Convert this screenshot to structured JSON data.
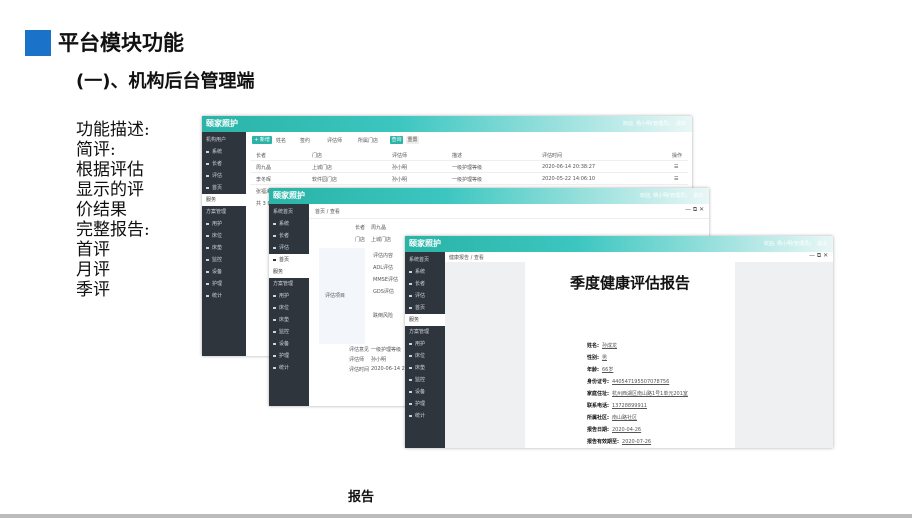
{
  "page": {
    "title": "平台模块功能",
    "subtitle": "(一)、机构后台管理端",
    "description_lines": [
      "功能描述:",
      "简评:",
      "根据评估",
      "显示的评",
      "价结果",
      "完整报告:",
      "首评",
      "月评",
      "季评"
    ],
    "caption": "报告",
    "accent_color": "#1a73c9"
  },
  "app": {
    "brand": "颐家照护",
    "user": "欢迎, 杨小明(管理员)",
    "logout": "退出"
  },
  "window1": {
    "sidebar_header": "机构用户",
    "nav": [
      "系统",
      "长者",
      "评估",
      "首页",
      "服务",
      "方案管理",
      "用护",
      "床位",
      "床垫",
      "监控",
      "设备",
      "护理",
      "统计"
    ],
    "toolbar": {
      "add": "+ 新增",
      "search": "查询",
      "reset": "重置"
    },
    "filters": [
      "姓名",
      "签约",
      "评估师",
      "所属门店"
    ],
    "table_headers": [
      "长者",
      "门店",
      "评估师",
      "描述",
      "评估时间",
      "操作"
    ],
    "rows": [
      [
        "周九晶",
        "上城门店",
        "孙小明",
        "一级护理等级",
        "2020-06-14 20:38:27",
        "☰"
      ],
      [
        "李冬晖",
        "软件园门店",
        "孙小明",
        "一级护理等级",
        "2020-05-22 14:06:10",
        "☰"
      ],
      [
        "张福海",
        "",
        "",
        "",
        "",
        ""
      ]
    ],
    "pager": "共 3 条"
  },
  "window2": {
    "sidebar_header": "系统首页",
    "nav": [
      "系统",
      "长者",
      "评估",
      "首页",
      "服务",
      "方案管理",
      "用护",
      "床位",
      "床垫",
      "监控",
      "设备",
      "护理",
      "统计"
    ],
    "breadcrumb": "首页 / 查看",
    "labels": [
      "长者",
      "门店",
      "评估项目",
      "评估师",
      "评估时间",
      "评估意见"
    ],
    "values": [
      "周九晶",
      "上城门店",
      "",
      "孙小明",
      "2020-06-14 20:38:27",
      "一级护理等级"
    ],
    "section_header": "评估内容",
    "items": [
      "ADL评估",
      "MMSE评估",
      "GDS评估",
      "跌倒风险"
    ]
  },
  "window3": {
    "sidebar_header": "系统首页",
    "nav": [
      "系统",
      "长者",
      "评估",
      "首页",
      "服务",
      "方案管理",
      "用护",
      "床位",
      "床垫",
      "监控",
      "设备",
      "护理",
      "统计"
    ],
    "breadcrumb": "健康报告 / 查看",
    "report": {
      "title": "季度健康评估报告",
      "fields": [
        {
          "label": "姓名:",
          "value": "孙成龙"
        },
        {
          "label": "性别:",
          "value": "男"
        },
        {
          "label": "年龄:",
          "value": "66岁"
        },
        {
          "label": "身份证号:",
          "value": "440547195507078756"
        },
        {
          "label": "家庭住址:",
          "value": "杭州西湖区南山路1号1单元201室"
        },
        {
          "label": "联系电话:",
          "value": "13728899911"
        },
        {
          "label": "所属社区:",
          "value": "南山路社区"
        },
        {
          "label": "报告日期:",
          "value": "2020-04-26"
        },
        {
          "label": "报告有效期至:",
          "value": "2020-07-26"
        }
      ]
    }
  }
}
